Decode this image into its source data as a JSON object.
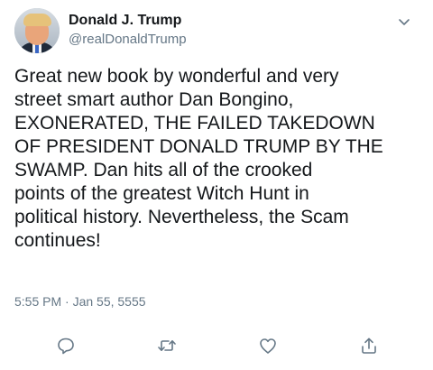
{
  "tweet": {
    "author": {
      "display_name": "Donald J. Trump",
      "handle": "@realDonaldTrump",
      "avatar": "profile-photo"
    },
    "text": "Great new book by wonderful and very\nstreet smart author Dan Bongino,\nEXONERATED, THE FAILED TAKEDOWN\nOF PRESIDENT DONALD TRUMP BY THE\nSWAMP. Dan hits all of the crooked\npoints of the greatest Witch Hunt in\npolitical history. Nevertheless, the Scam\ncontinues!",
    "timestamp": "5:55 PM · Jan 55, 5555",
    "menu_icon": "chevron-down-icon",
    "actions": [
      {
        "name": "reply",
        "icon": "reply-icon"
      },
      {
        "name": "retweet",
        "icon": "retweet-icon"
      },
      {
        "name": "like",
        "icon": "heart-icon"
      },
      {
        "name": "share",
        "icon": "share-icon"
      }
    ]
  },
  "colors": {
    "text_primary": "#14171a",
    "text_secondary": "#657786",
    "icon": "#657786",
    "background": "#ffffff"
  }
}
